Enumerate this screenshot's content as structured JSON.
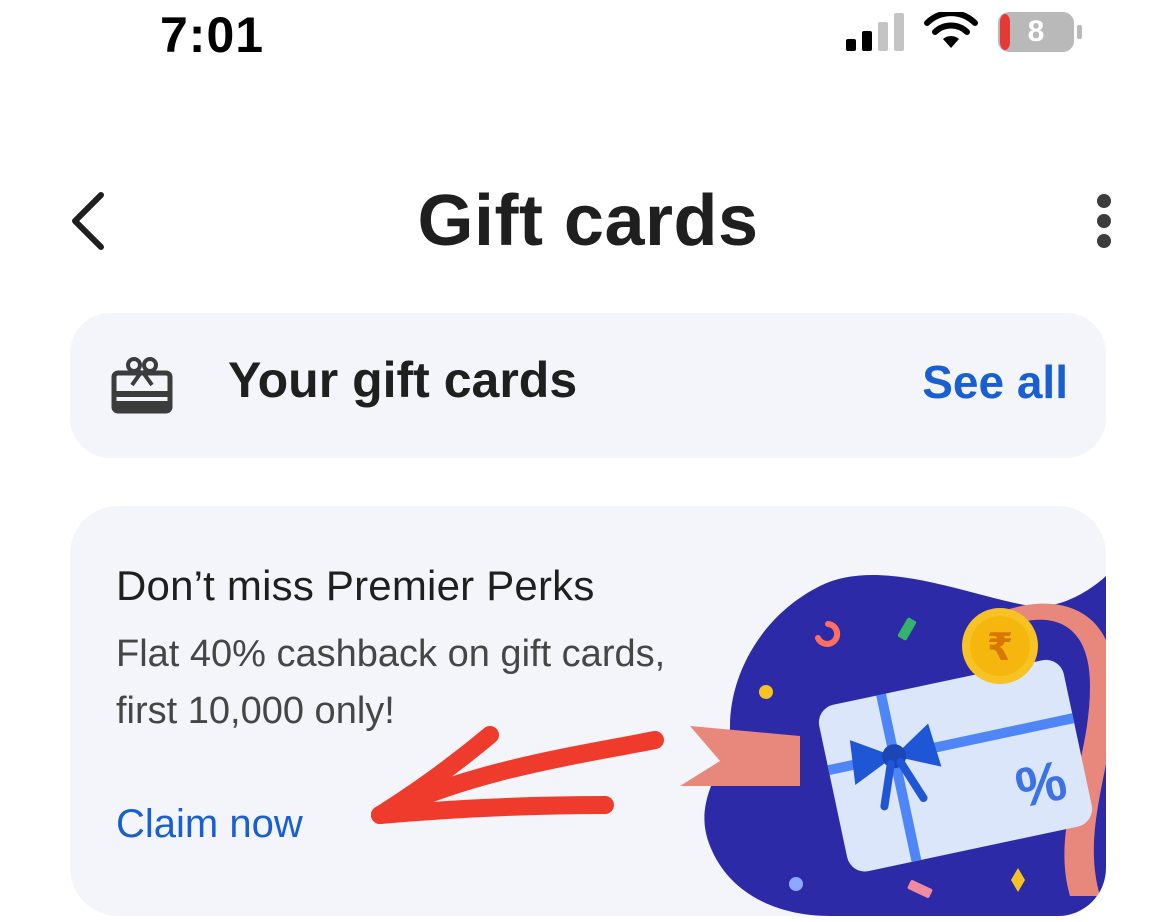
{
  "status_bar": {
    "time": "7:01",
    "battery_level": "8",
    "icons": [
      "signal-icon",
      "wifi-icon",
      "battery-icon"
    ]
  },
  "app_bar": {
    "title": "Gift cards",
    "back_icon": "chevron-left-icon",
    "more_icon": "more-vert-icon"
  },
  "your_gift_cards": {
    "icon": "gift-card-icon",
    "label": "Your gift cards",
    "action": "See all"
  },
  "promo": {
    "title": "Don’t miss Premier Perks",
    "description": "Flat 40% cashback on gift cards, first 10,000 only!",
    "cta": "Claim now",
    "illustration_icons": [
      "gift-card-illustration",
      "rupee-coin-icon",
      "percent-icon",
      "bow-icon"
    ],
    "rupee_symbol": "₹",
    "percent_symbol": "%"
  },
  "annotation": {
    "icon": "red-arrow-annotation"
  },
  "colors": {
    "accent": "#1a5fcf",
    "card_background": "#f3f5fa",
    "illustration_background": "#2d2aa8",
    "ribbon": "#e8877b",
    "coin": "#f7c223",
    "annotation": "#ef3b2c",
    "battery_low": "#e53935"
  }
}
